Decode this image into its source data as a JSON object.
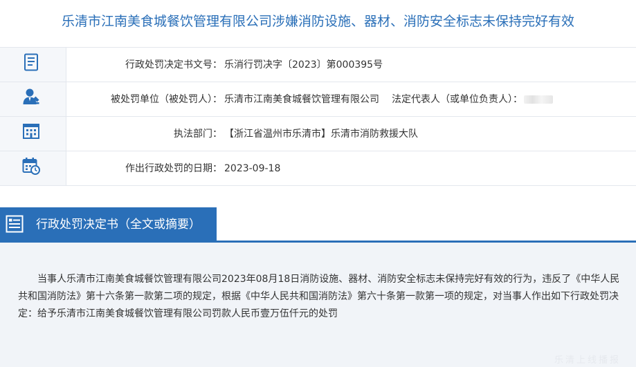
{
  "page": {
    "title": "乐清市江南美食城餐饮管理有限公司涉嫌消防设施、器材、消防安全标志未保持完好有效"
  },
  "info_rows": [
    {
      "icon": "document-icon",
      "label": "行政处罚决定书文号：",
      "value": "乐消行罚决字〔2023〕第000395号"
    },
    {
      "icon": "person-icon",
      "label": "被处罚单位（被处罚人）：",
      "value": "乐清市江南美食城餐饮管理有限公司",
      "extra_label": "法定代表人（或单位负责人）："
    },
    {
      "icon": "building-icon",
      "label": "执法部门：",
      "value": "【浙江省温州市乐清市】乐清市消防救援大队"
    },
    {
      "icon": "calendar-clock-icon",
      "label": "作出行政处罚的日期：",
      "value": "2023-09-18"
    }
  ],
  "section": {
    "icon": "document-list-icon",
    "title": "行政处罚决定书（全文或摘要）",
    "body": "当事人乐清市江南美食城餐饮管理有限公司2023年08月18日消防设施、器材、消防安全标志未保持完好有效的行为，违反了《中华人民共和国消防法》第十六条第一款第二项的规定，根据《中华人民共和国消防法》第六十条第一款第一项的规定，对当事人作出如下行政处罚决定：给予乐清市江南美食城餐饮管理有限公司罚款人民币壹万伍仟元的处罚"
  },
  "watermark": "乐清上线播报",
  "colors": {
    "accent": "#2a6fb8",
    "panel_bg": "#f1f4f8",
    "icon_cell_bg": "#f5f7fa",
    "border": "#e3e7ed",
    "text": "#333333"
  }
}
